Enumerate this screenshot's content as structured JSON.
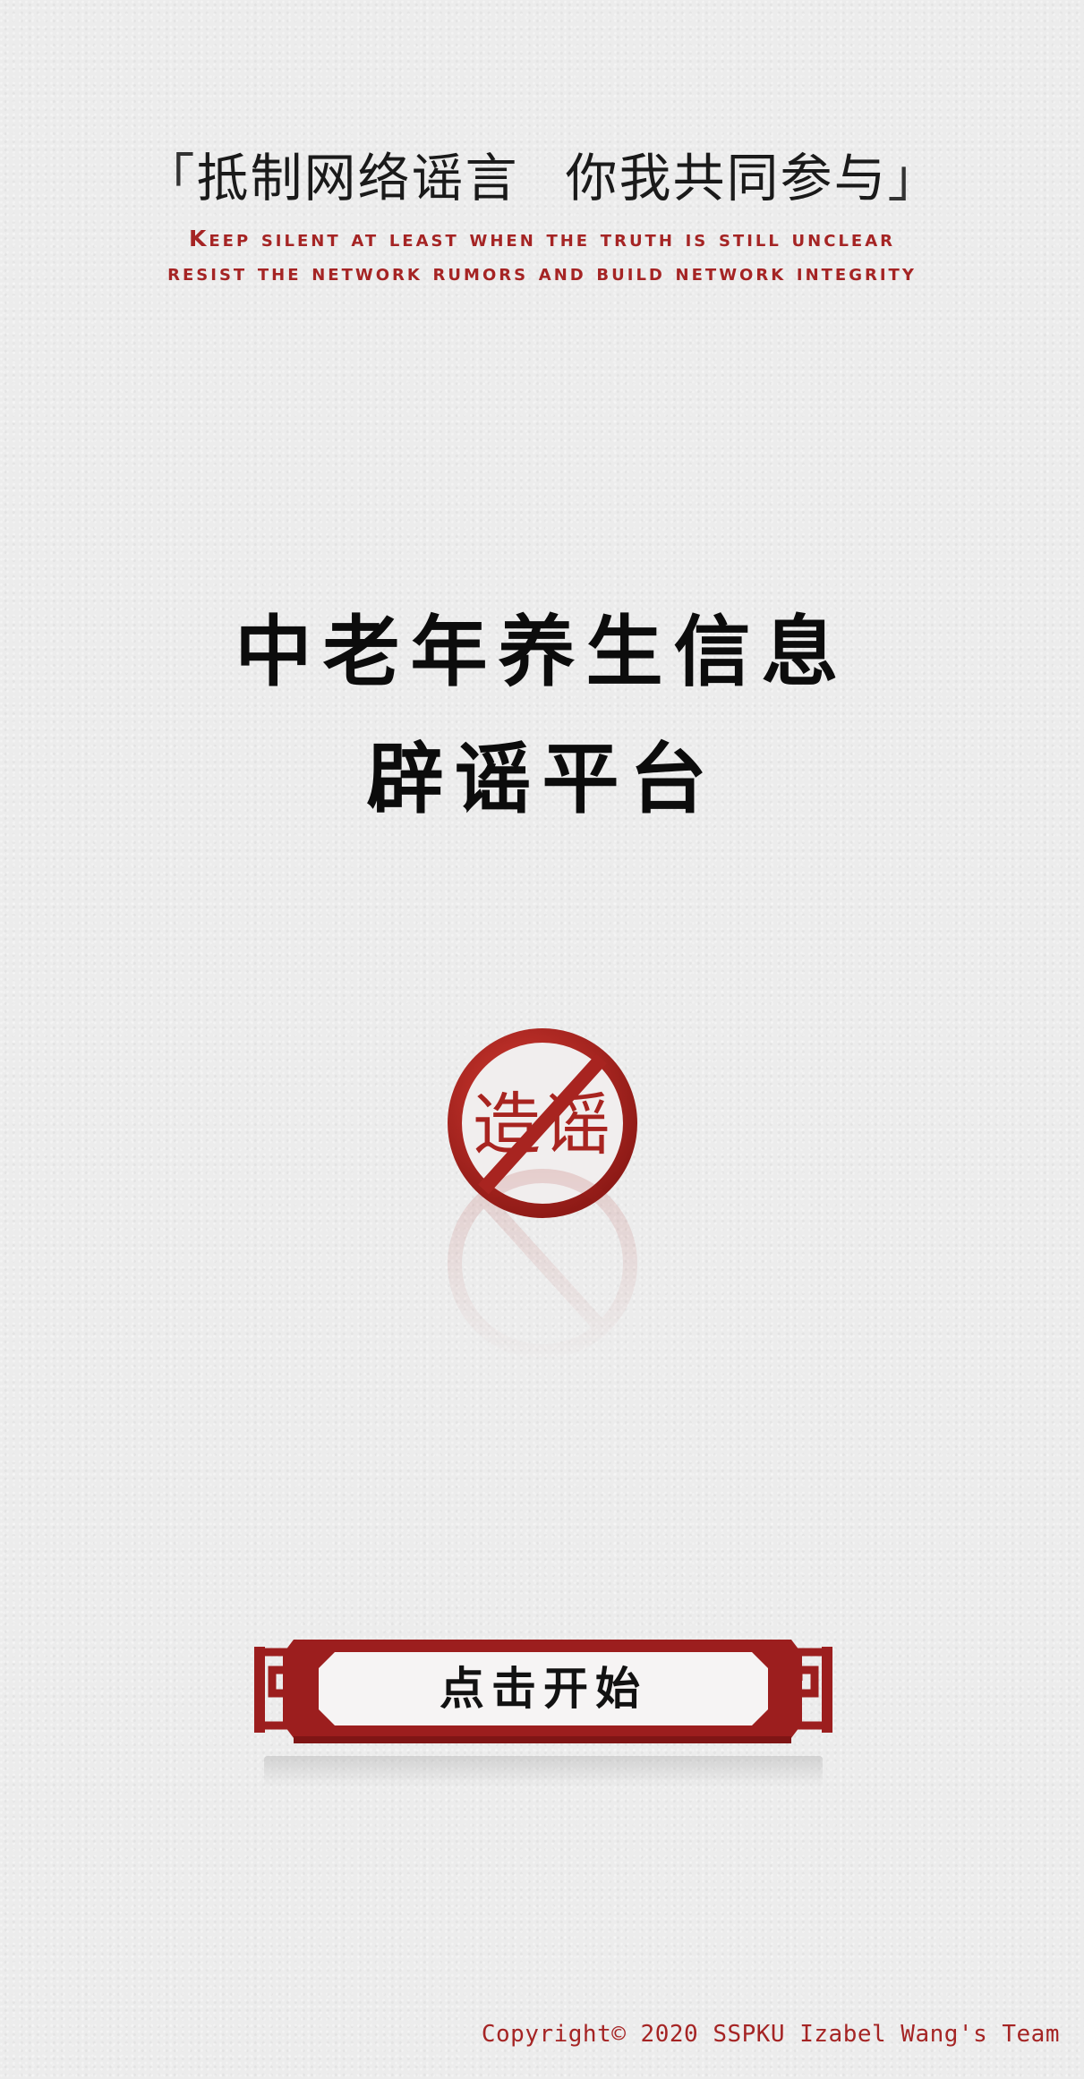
{
  "header": {
    "slogan_open": "「",
    "slogan_part1": "抵制网络谣言",
    "slogan_part2": "你我共同参与",
    "slogan_close": "」",
    "english_line1": "Keep silent at least when the truth is still unclear",
    "english_line2": "resist the network rumors and build network integrity"
  },
  "title": {
    "line1": "中老年养生信息",
    "line2": "辟谣平台"
  },
  "emblem": {
    "text_left": "造",
    "text_right": "谣",
    "icon": "no-rumor-prohibition-icon"
  },
  "start_button": {
    "label": "点击开始"
  },
  "footer": {
    "copyright": "Copyright© 2020 SSPKU Izabel Wang's Team"
  },
  "colors": {
    "accent_red": "#a52424",
    "background": "#ececec",
    "title_text": "#0c0c0c"
  }
}
